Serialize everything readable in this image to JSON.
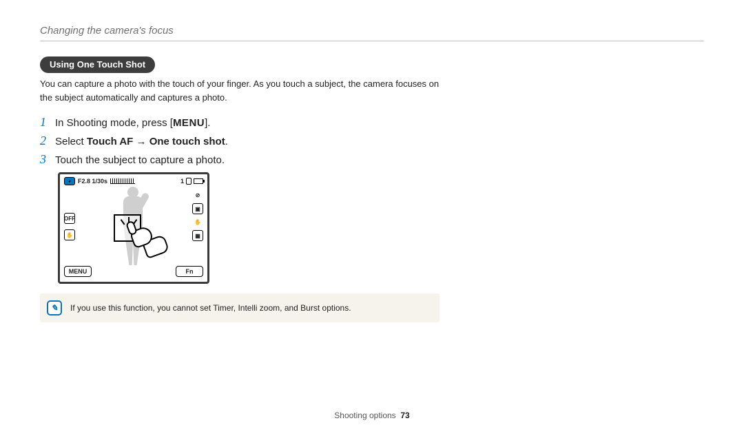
{
  "header": {
    "title": "Changing the camera's focus"
  },
  "section": {
    "pill": "Using One Touch Shot",
    "intro": "You can capture a photo with the touch of your finger. As you touch a subject, the camera focuses on the subject automatically and captures a photo."
  },
  "steps": [
    {
      "num": "1",
      "pre": "In Shooting mode, press [",
      "menu": "MENU",
      "post": "]."
    },
    {
      "num": "2",
      "pre": "Select ",
      "bold1": "Touch AF",
      "arrow": " → ",
      "bold2": "One touch shot",
      "post": "."
    },
    {
      "num": "3",
      "text": "Touch the subject to capture a photo."
    }
  ],
  "lcd": {
    "exposure": "F2.8 1/30s",
    "soft_left": "MENU",
    "soft_right": "Fn",
    "left_icons": [
      "OFF",
      "✋"
    ],
    "right_icons": [
      "⊘",
      "▣",
      "✋",
      "▦"
    ],
    "top_count": "1"
  },
  "note": {
    "text": "If you use this function, you cannot set Timer, Intelli zoom, and Burst options."
  },
  "footer": {
    "section": "Shooting options",
    "page": "73"
  }
}
